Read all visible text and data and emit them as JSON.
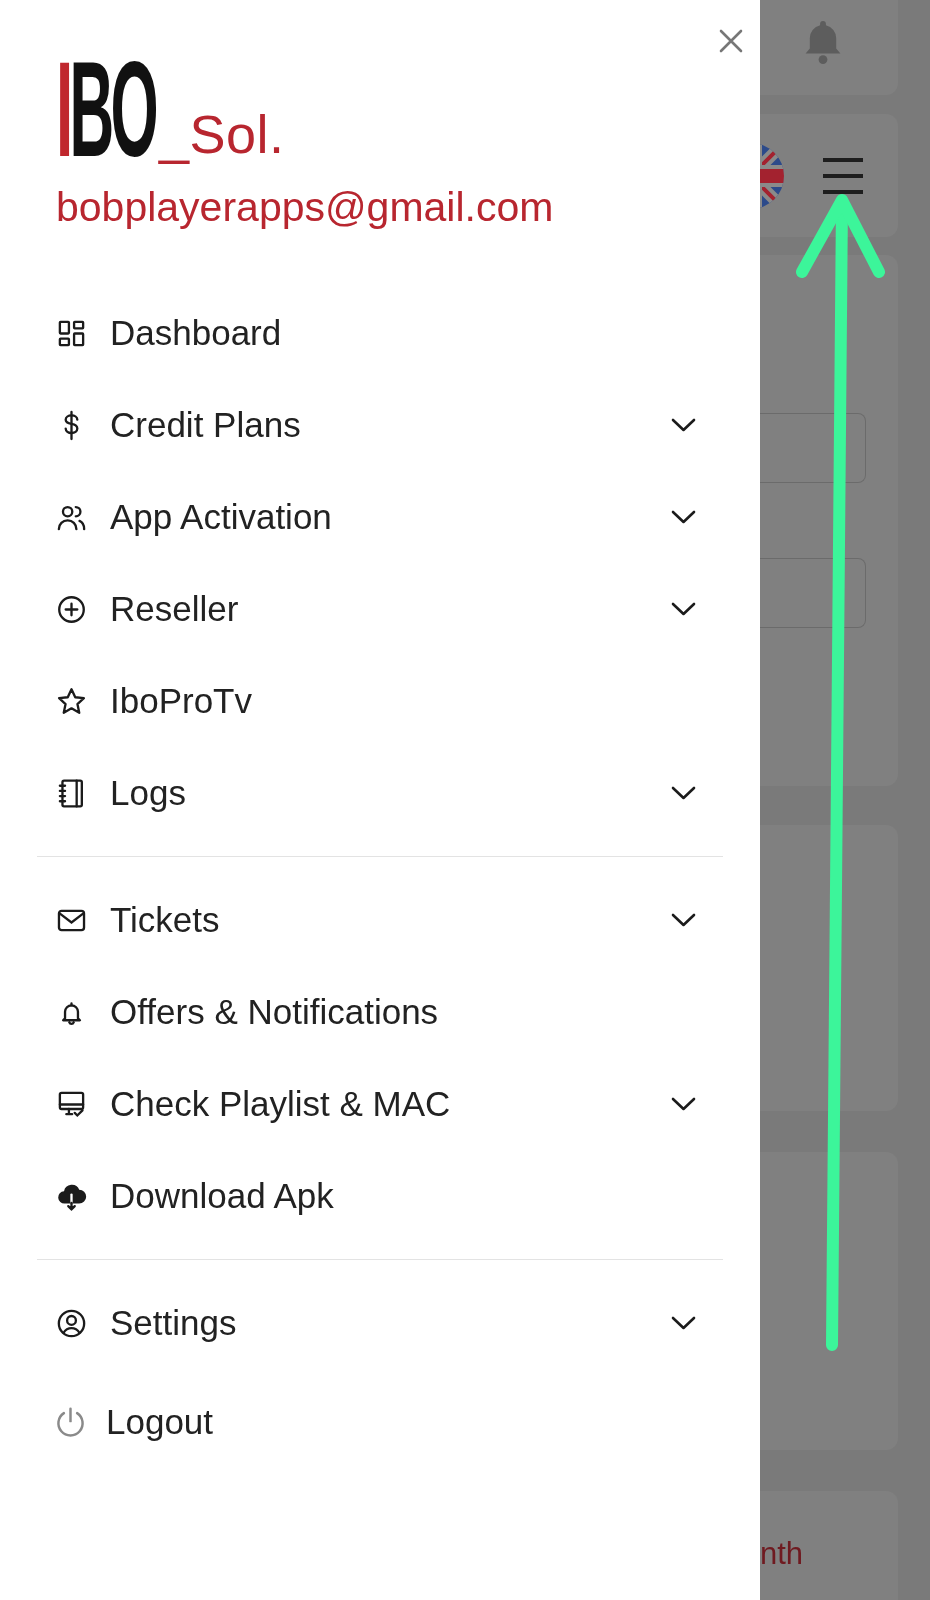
{
  "drawer": {
    "logo": {
      "mark": "IBO",
      "suffix": "_Sol."
    },
    "email": "bobplayerapps@gmail.com",
    "sections": [
      {
        "items": [
          {
            "kind": "nav",
            "label": "Dashboard",
            "submenu": false
          },
          {
            "kind": "nav",
            "label": "Credit Plans",
            "submenu": true
          },
          {
            "kind": "nav",
            "label": "App Activation",
            "submenu": true
          },
          {
            "kind": "nav",
            "label": "Reseller",
            "submenu": true
          },
          {
            "kind": "nav",
            "label": "IboProTv",
            "submenu": false
          },
          {
            "kind": "nav",
            "label": "Logs",
            "submenu": true
          }
        ]
      },
      {
        "items": [
          {
            "kind": "nav",
            "label": "Tickets",
            "submenu": true
          },
          {
            "kind": "nav",
            "label": "Offers & Notifications",
            "submenu": false
          },
          {
            "kind": "nav",
            "label": "Check Playlist & MAC",
            "submenu": true
          },
          {
            "kind": "nav",
            "label": "Download Apk",
            "submenu": false
          }
        ]
      },
      {
        "items": [
          {
            "kind": "nav",
            "label": "Settings",
            "submenu": true
          },
          {
            "kind": "logout",
            "label": "Logout",
            "submenu": false
          }
        ]
      }
    ]
  },
  "background_page": {
    "card_text": "nth"
  }
}
